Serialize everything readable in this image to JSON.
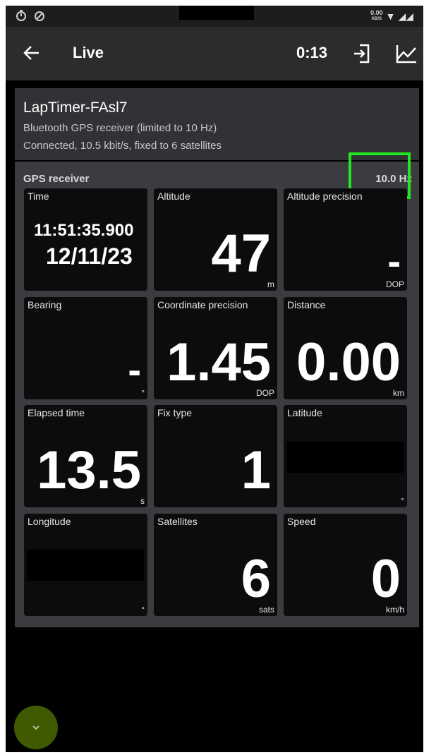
{
  "status_bar": {
    "left_icons": [
      "timer-icon",
      "do-not-disturb-icon"
    ],
    "net_speed_top": "0.00",
    "net_speed_bottom": "KB/S",
    "wifi_glyph": "▼",
    "signal_glyph": "◢◢"
  },
  "app_bar": {
    "title": "Live",
    "timer": "0:13"
  },
  "device": {
    "name": "LapTimer-FAsl7",
    "description": "Bluetooth GPS receiver (limited to 10 Hz)",
    "status": "Connected, 10.5 kbit/s, fixed to 6 satellites"
  },
  "gps": {
    "title": "GPS receiver",
    "rate": "10.0 Hz",
    "tiles": {
      "time": {
        "label": "Time",
        "time": "11:51:35.900",
        "date": "12/11/23"
      },
      "altitude": {
        "label": "Altitude",
        "value": "47",
        "unit": "m"
      },
      "altitude_precision": {
        "label": "Altitude precision",
        "value": "-",
        "unit": "DOP"
      },
      "bearing": {
        "label": "Bearing",
        "value": "-",
        "unit": "°"
      },
      "coordinate_precision": {
        "label": "Coordinate precision",
        "value": "1.45",
        "unit": "DOP"
      },
      "distance": {
        "label": "Distance",
        "value": "0.00",
        "unit": "km"
      },
      "elapsed_time": {
        "label": "Elapsed time",
        "value": "13.5",
        "unit": "s"
      },
      "fix_type": {
        "label": "Fix type",
        "value": "1",
        "unit": ""
      },
      "latitude": {
        "label": "Latitude",
        "unit": "°"
      },
      "longitude": {
        "label": "Longitude",
        "unit": "°"
      },
      "satellites": {
        "label": "Satellites",
        "value": "6",
        "unit": "sats"
      },
      "speed": {
        "label": "Speed",
        "value": "0",
        "unit": "km/h"
      }
    }
  },
  "colors": {
    "highlight": "#22e622",
    "fab": "#3f5a00"
  }
}
